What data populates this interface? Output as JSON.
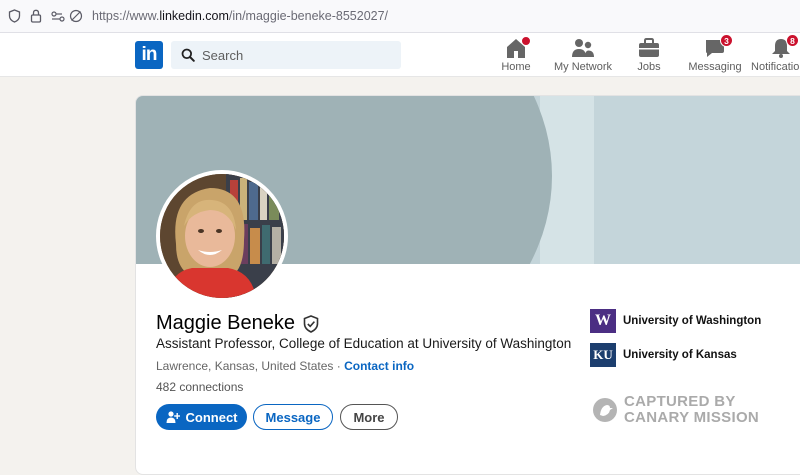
{
  "browser": {
    "url_prefix": "https://www.",
    "url_host": "linkedin.com",
    "url_path": "/in/maggie-beneke-8552027/"
  },
  "nav": {
    "logo_text": "in",
    "search_placeholder": "Search",
    "items": [
      {
        "label": "Home",
        "icon": "home-icon",
        "badge": ""
      },
      {
        "label": "My Network",
        "icon": "people-icon",
        "badge": ""
      },
      {
        "label": "Jobs",
        "icon": "briefcase-icon",
        "badge": ""
      },
      {
        "label": "Messaging",
        "icon": "chat-icon",
        "badge": "3"
      },
      {
        "label": "Notifications",
        "icon": "bell-icon",
        "badge": "8"
      }
    ]
  },
  "profile": {
    "name": "Maggie Beneke",
    "headline": "Assistant Professor, College of Education at University of Washington",
    "location": "Lawrence, Kansas, United States",
    "location_separator": " · ",
    "contact_info": "Contact info",
    "connections": "482 connections",
    "buttons": {
      "connect": "Connect",
      "message": "Message",
      "more": "More"
    },
    "education": [
      {
        "name": "University of Washington",
        "logo_text": "W"
      },
      {
        "name": "University of Kansas",
        "logo_text": "KU"
      }
    ]
  },
  "watermark": {
    "line1": "CAPTURED BY",
    "line2": "CANARY MISSION"
  },
  "colors": {
    "brand": "#0a66c2",
    "badge": "#cb112d",
    "uw_purple": "#4b2e83",
    "ku_blue": "#1c3e6e"
  }
}
